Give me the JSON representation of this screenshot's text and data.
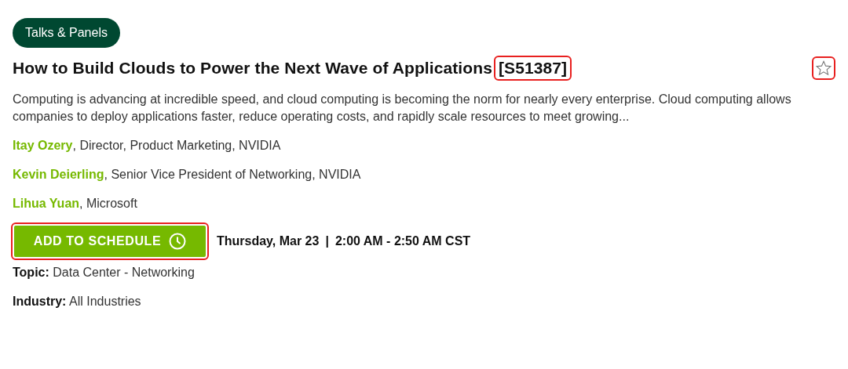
{
  "session": {
    "tag": "Talks & Panels",
    "title": "How to Build Clouds to Power the Next Wave of Applications",
    "code": {
      "text": "[S51387]",
      "highlighted": true
    },
    "favorite": {
      "starred": false,
      "highlighted": true
    },
    "description": "Computing is advancing at incredible speed, and cloud computing is becoming the norm for nearly every enterprise. Cloud computing allows companies to deploy applications faster, reduce operating costs, and rapidly scale resources to meet growing...",
    "speakers": [
      {
        "name": "Itay Ozery",
        "role": ", Director, Product Marketing, NVIDIA"
      },
      {
        "name": "Kevin Deierling",
        "role": ", Senior Vice President of Networking, NVIDIA"
      },
      {
        "name": "Lihua Yuan",
        "role": ", Microsoft"
      }
    ],
    "schedule_button": {
      "label": "ADD TO SCHEDULE",
      "highlighted": true
    },
    "date": "Thursday, Mar 23",
    "separator": "|",
    "time": "2:00 AM - 2:50 AM CST",
    "details": [
      {
        "label": "Topic:",
        "value": "Data Center - Networking"
      },
      {
        "label": "Industry:",
        "value": "All Industries"
      }
    ]
  }
}
